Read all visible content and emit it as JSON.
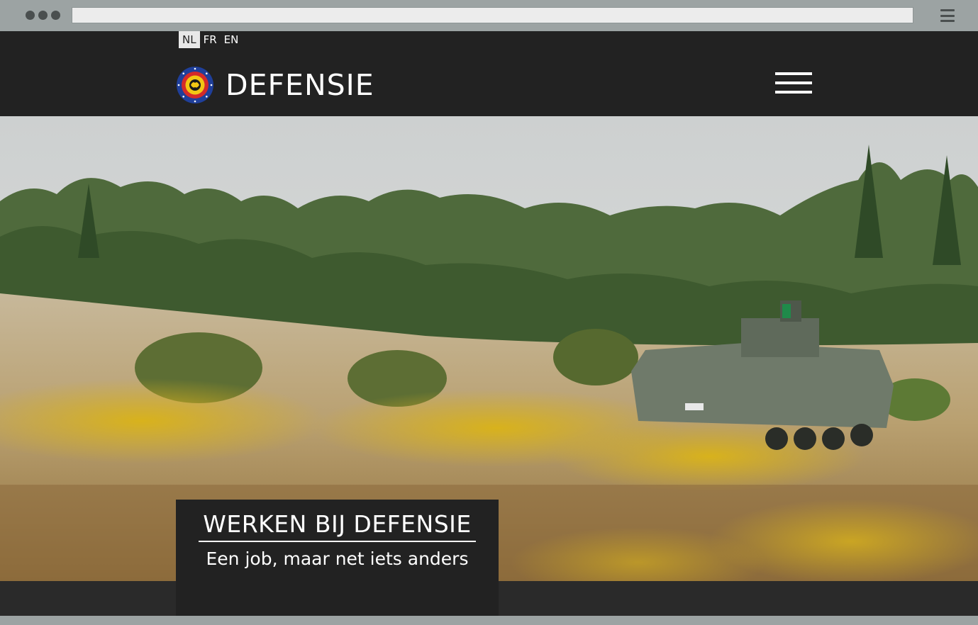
{
  "header": {
    "languages": [
      {
        "code": "NL",
        "active": true
      },
      {
        "code": "FR",
        "active": false
      },
      {
        "code": "EN",
        "active": false
      }
    ],
    "brand": "DEFENSIE",
    "logo_icon": "belgian-defence-seal-icon",
    "menu_icon": "hamburger-menu-icon"
  },
  "hero": {
    "title": "WERKEN BIJ DEFENSIE",
    "subtitle": "Een job, maar net iets anders",
    "image": "armored-vehicle-in-field-photo"
  },
  "colors": {
    "header_bg": "#222222",
    "chrome_bg": "#9ca3a3",
    "text": "#ffffff"
  }
}
